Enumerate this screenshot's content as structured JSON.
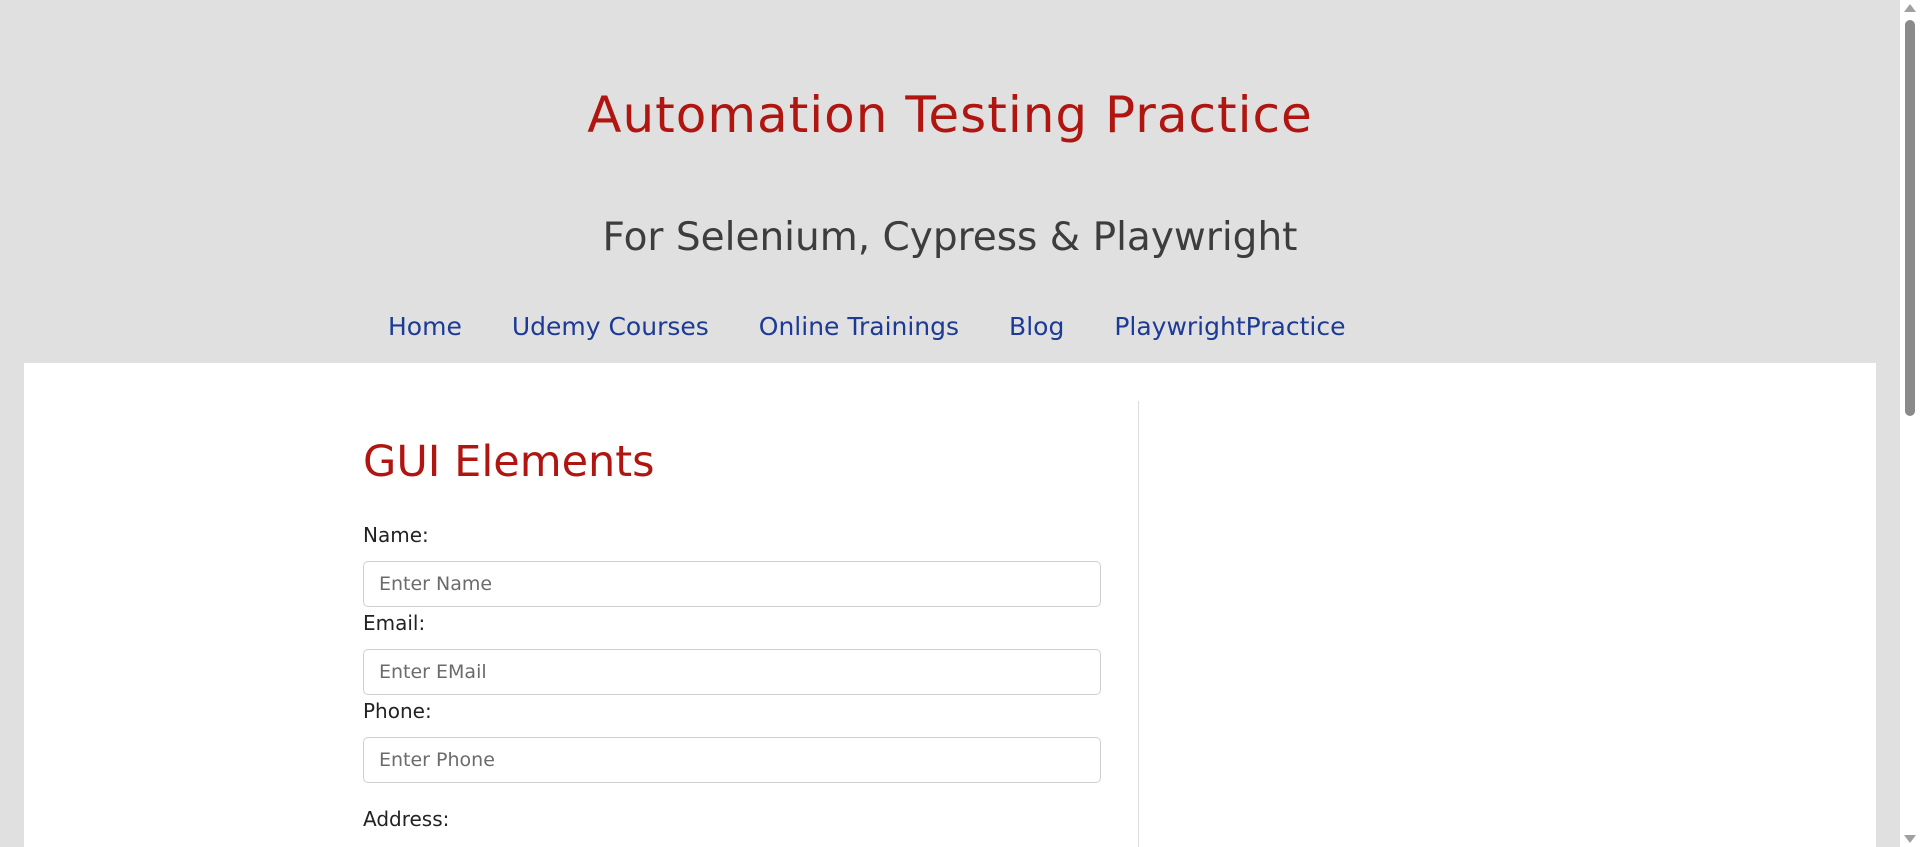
{
  "header": {
    "title": "Automation Testing Practice",
    "subtitle": "For Selenium, Cypress & Playwright"
  },
  "nav": {
    "items": [
      {
        "label": "Home"
      },
      {
        "label": "Udemy Courses"
      },
      {
        "label": "Online Trainings"
      },
      {
        "label": "Blog"
      },
      {
        "label": "PlaywrightPractice"
      }
    ]
  },
  "main": {
    "section_title": "GUI Elements",
    "fields": {
      "name": {
        "label": "Name:",
        "placeholder": "Enter Name",
        "value": ""
      },
      "email": {
        "label": "Email:",
        "placeholder": "Enter EMail",
        "value": ""
      },
      "phone": {
        "label": "Phone:",
        "placeholder": "Enter Phone",
        "value": ""
      },
      "address": {
        "label": "Address:"
      }
    }
  },
  "colors": {
    "title": "#b01510",
    "nav_link": "#1c3a96",
    "header_bg": "#e0e0e0",
    "content_bg": "#ffffff"
  },
  "icons": {
    "scroll_up": "scroll-up-arrow-icon",
    "scroll_down": "scroll-down-arrow-icon"
  }
}
